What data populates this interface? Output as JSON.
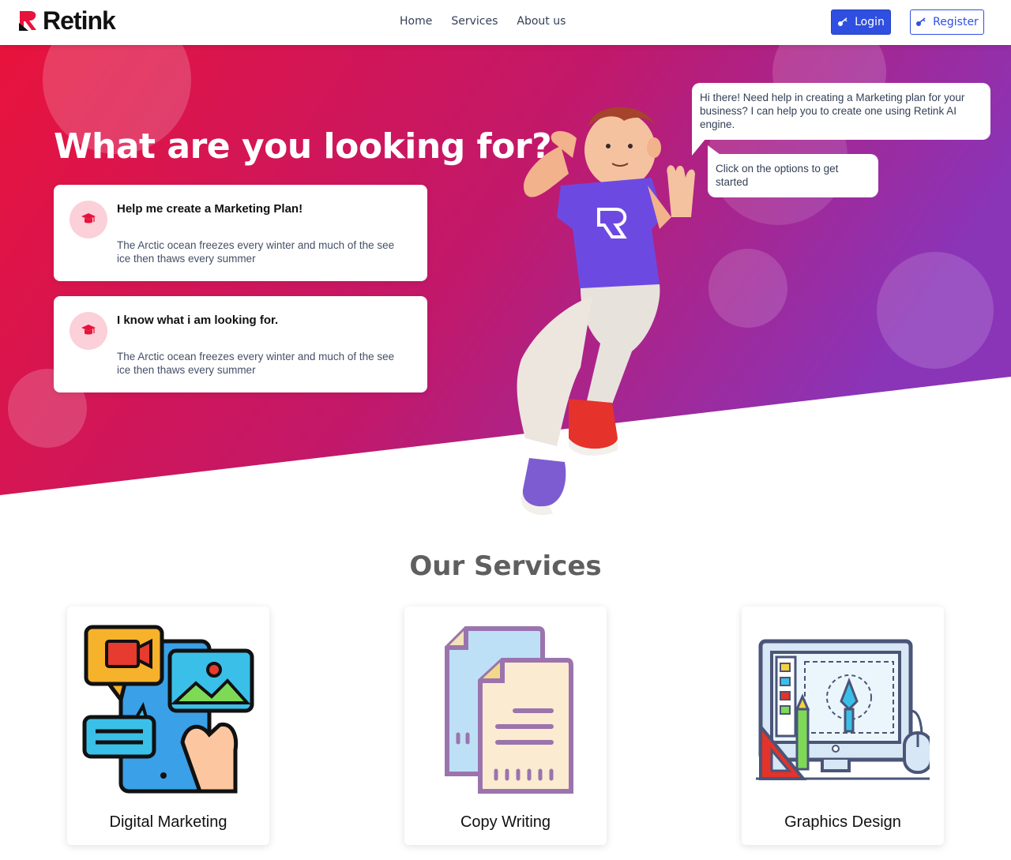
{
  "brand": {
    "name": "Retink",
    "primary": "#2f4fe0",
    "hero_gradient": [
      "#e8133c",
      "#8a34b8"
    ]
  },
  "nav": {
    "links": [
      "Home",
      "Services",
      "About us"
    ],
    "login_label": "Login",
    "register_label": "Register"
  },
  "hero": {
    "title": "What are you looking for?",
    "options": [
      {
        "title": "Help me create a Marketing Plan!",
        "description": "The Arctic ocean freezes every winter and much of the see ice then thaws every summer",
        "icon": "graduation-cap-icon"
      },
      {
        "title": "I know what i am looking for.",
        "description": "The Arctic ocean freezes every winter and much of the see ice then thaws every summer",
        "icon": "graduation-cap-icon"
      }
    ],
    "chat": {
      "message_1": "Hi there! Need help in creating a Marketing plan for your business? I can help you to create one using Retink AI engine.",
      "message_2": "Click on the options to get started"
    }
  },
  "services": {
    "title": "Our Services",
    "items": [
      {
        "label": "Digital Marketing",
        "icon": "digital-marketing-illustration"
      },
      {
        "label": "Copy Writing",
        "icon": "copy-writing-illustration"
      },
      {
        "label": "Graphics Design",
        "icon": "graphics-design-illustration"
      }
    ]
  }
}
